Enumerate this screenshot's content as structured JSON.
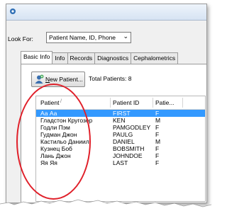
{
  "toolbar": {
    "lookfor_label": "Look For:",
    "lookfor_value": "Patient Name, ID, Phone"
  },
  "tabs": [
    {
      "label": "Basic Info",
      "active": true
    },
    {
      "label": "Info",
      "active": false
    },
    {
      "label": "Records",
      "active": false
    },
    {
      "label": "Diagnostics",
      "active": false
    },
    {
      "label": "Cephalometrics",
      "active": false
    }
  ],
  "actions": {
    "new_patient_label_u": "N",
    "new_patient_label_rest": "ew Patient...",
    "total_patients": "Total Patients: 8"
  },
  "table": {
    "columns": [
      "Patient",
      "Patient ID",
      "Patie..."
    ],
    "sort_indicator": "/",
    "selected_index": 0,
    "rows": [
      [
        "Аа Аа",
        "FIRST",
        "F"
      ],
      [
        "Гладстон Кругозор",
        "KEN",
        "M"
      ],
      [
        "Годли Пэм",
        "PAMGODLEY",
        "F"
      ],
      [
        "Гудман Джон",
        "PAULG",
        "F"
      ],
      [
        "Кастильо Даниил",
        "DANIEL",
        "M"
      ],
      [
        "Кузнец Боб",
        "BOBSMITH",
        "F"
      ],
      [
        "Лань Джон",
        "JOHNDOE",
        "F"
      ],
      [
        "Яя Яя",
        "LAST",
        "F"
      ]
    ]
  },
  "colors": {
    "selection": "#3399ff",
    "highlight_oval": "#e0202a"
  },
  "icons": {
    "app": "app-icon",
    "new_patient": "add-patient-icon",
    "dropdown": "chevron-down-icon"
  }
}
